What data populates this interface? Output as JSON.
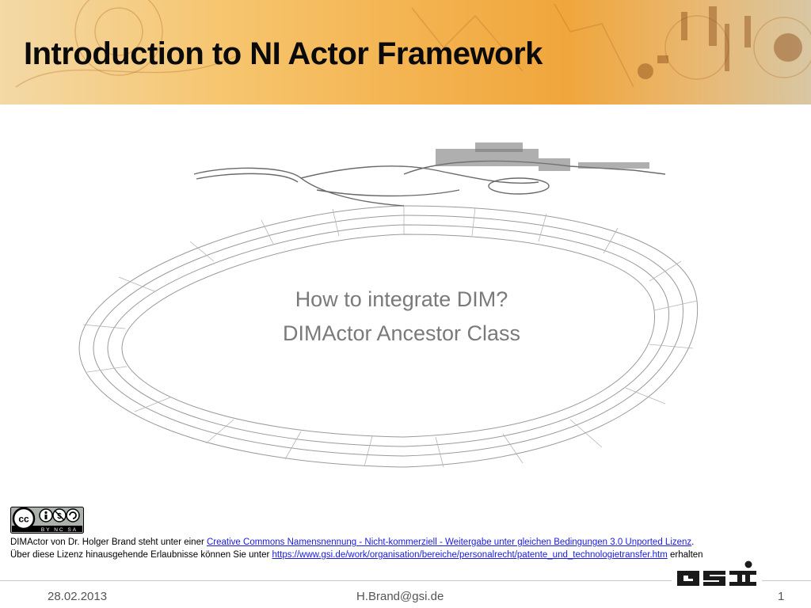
{
  "slide": {
    "title": "Introduction to NI Actor Framework",
    "subtitle_lines": [
      "How to integrate DIM?",
      "DIMActor Ancestor Class"
    ]
  },
  "license": {
    "badge_text": "BY NC SA",
    "line1_prefix": "DIMActor von Dr. Holger Brand steht unter einer ",
    "line1_link": "Creative Commons Namensnennung - Nicht-kommerziell - Weitergabe unter gleichen Bedingungen 3.0 Unported Lizenz",
    "line1_suffix": ".",
    "line2_prefix": "Über diese Lizenz hinausgehende Erlaubnisse können Sie unter ",
    "line2_link": "https://www.gsi.de/work/organisation/bereiche/personalrecht/patente_und_technologietransfer.htm",
    "line2_suffix": " erhalten"
  },
  "footer": {
    "date": "28.02.2013",
    "email": "H.Brand@gsi.de",
    "page_number": "1"
  },
  "logo": {
    "text": "GSI"
  },
  "colors": {
    "banner_orange": "#f4b451",
    "title_text": "#0a0a0a",
    "subtitle_text": "#7a7a7a",
    "link_blue": "#1a1ae0",
    "logo_dark": "#1a1a1a"
  },
  "icons": [
    "creative-commons-badge",
    "gsi-logo",
    "accelerator-ring-wireframe"
  ]
}
